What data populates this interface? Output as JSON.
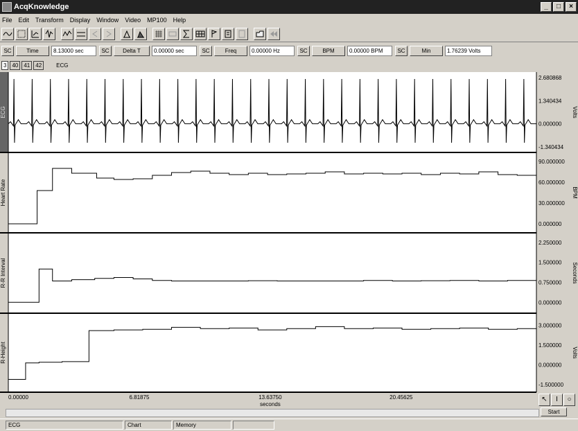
{
  "window": {
    "title": "AcqKnowledge",
    "controls": [
      "_",
      "□",
      "×"
    ]
  },
  "menu": [
    "File",
    "Edit",
    "Transform",
    "Display",
    "Window",
    "Video",
    "MP100",
    "Help"
  ],
  "toolbar_icons": [
    "wave-icon",
    "grid-icon",
    "scale-icon",
    "overlap-icon",
    "autoscale-icon",
    "compare-icon",
    "zoom-back-icon",
    "zoom-forward-icon",
    "print-icon",
    "print-preview-icon",
    "grid-toggle-icon",
    "marker-icon",
    "sum-icon",
    "table-icon",
    "flag-icon",
    "journal-icon",
    "journal-paste-icon",
    "open-icon",
    "rewind-icon"
  ],
  "measurements": [
    {
      "sc": "SC",
      "label": "Time",
      "value": "8.13000 sec"
    },
    {
      "sc": "SC",
      "label": "Delta T",
      "value": "0.00000 sec"
    },
    {
      "sc": "SC",
      "label": "Freq",
      "value": "0.00000 Hz"
    },
    {
      "sc": "SC",
      "label": "BPM",
      "value": "0.00000 BPM"
    },
    {
      "sc": "SC",
      "label": "Min",
      "value": "1.76239 Volts"
    }
  ],
  "channel_buttons": [
    "3",
    "40",
    "41",
    "42"
  ],
  "active_channel": "ECG",
  "chart_data": [
    {
      "type": "line",
      "title": "",
      "ylabel": "ECG",
      "unit": "Volts",
      "yticks": [
        "2.680868",
        "1.340434",
        "0.000000",
        "-1.340434"
      ],
      "ylim": [
        -1.34,
        2.68
      ],
      "beats_per_window": 29
    },
    {
      "type": "line",
      "title": "",
      "ylabel": "Heart Rate",
      "unit": "BPM",
      "yticks": [
        "90.000000",
        "60.000000",
        "30.000000",
        "0.000000"
      ],
      "ylim": [
        -5,
        95
      ],
      "x": [
        0,
        1.5,
        2.3,
        3.3,
        4.6,
        5.5,
        6.5,
        7.5,
        8.5,
        9.5,
        10.5,
        11.5,
        12.5,
        13.5,
        14.5,
        15.5,
        16.5,
        17.5,
        18.5,
        19.5,
        20.5,
        21.5,
        22.5,
        23.5,
        24.5,
        25.5,
        26.5,
        27.5
      ],
      "values": [
        0,
        48,
        80,
        73,
        66,
        64,
        65,
        70,
        74,
        76,
        73,
        71,
        73,
        71,
        72,
        73,
        75,
        72,
        73,
        72,
        73,
        71,
        73,
        72,
        75,
        71,
        70,
        65
      ]
    },
    {
      "type": "line",
      "title": "",
      "ylabel": "R-R Interval",
      "unit": "Seconds",
      "yticks": [
        "2.250000",
        "1.500000",
        "0.750000",
        "0.000000"
      ],
      "ylim": [
        -0.2,
        2.4
      ],
      "x": [
        0,
        1.3,
        1.6,
        2.3,
        3.3,
        4.5,
        5.5,
        6.5,
        7.5,
        8.5,
        9.5,
        11,
        12.5,
        14,
        15.5,
        17,
        18.5,
        20,
        21.5,
        23,
        24.5,
        26,
        27.5
      ],
      "values": [
        0,
        0,
        1.25,
        0.8,
        0.85,
        0.9,
        0.93,
        0.88,
        0.82,
        0.8,
        0.8,
        0.8,
        0.81,
        0.8,
        0.8,
        0.8,
        0.82,
        0.8,
        0.81,
        0.82,
        0.8,
        0.82,
        0.83
      ]
    },
    {
      "type": "line",
      "title": "",
      "ylabel": "R-Height",
      "unit": "Volts",
      "yticks": [
        "3.000000",
        "1.500000",
        "0.000000",
        "-1.500000"
      ],
      "ylim": [
        -1.65,
        3.5
      ],
      "x": [
        0,
        0.9,
        1.6,
        2.8,
        4.2,
        5.5,
        7,
        8.5,
        10,
        11.5,
        13,
        14.5,
        16,
        17.5,
        19,
        20.5,
        22,
        23.5,
        25,
        26.5,
        27.5
      ],
      "values": [
        -1.1,
        0.15,
        0.2,
        0.25,
        2.6,
        2.65,
        2.7,
        2.85,
        2.75,
        2.8,
        2.65,
        2.75,
        2.9,
        2.75,
        2.8,
        2.7,
        2.75,
        2.8,
        2.7,
        2.75,
        2.6
      ]
    }
  ],
  "x_axis": {
    "ticks": [
      "0.00000",
      "6.81875",
      "13.63750",
      "20.45625"
    ],
    "label": "seconds",
    "range": [
      0,
      27.5
    ]
  },
  "cursor_tools": [
    "arrow-cursor-icon",
    "ibeam-cursor-icon",
    "zoom-cursor-icon"
  ],
  "start_label": "Start",
  "status": {
    "channel": "ECG",
    "chart": "Chart",
    "memory": "Memory"
  }
}
